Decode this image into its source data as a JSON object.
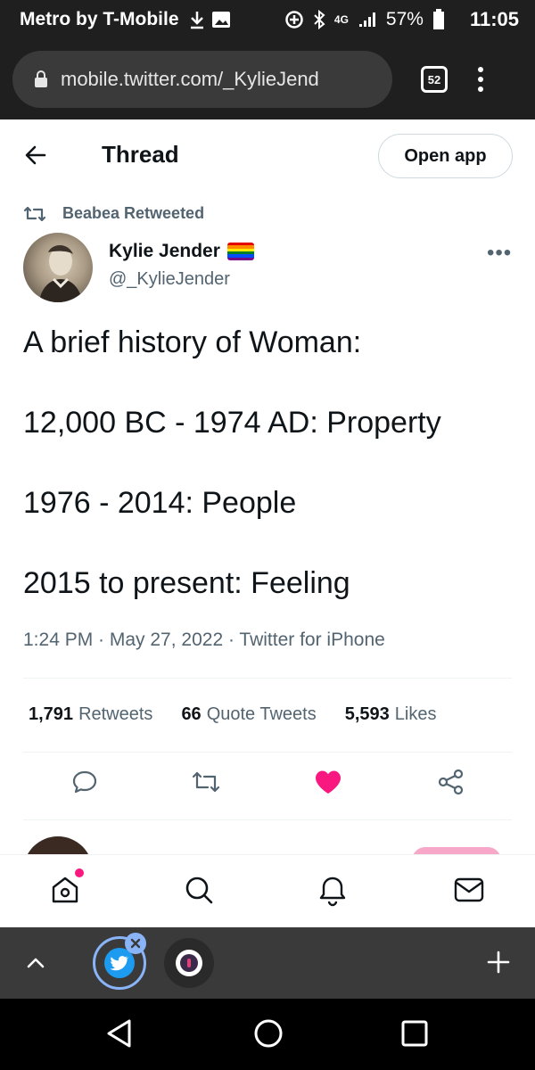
{
  "status_bar": {
    "carrier": "Metro by T-Mobile",
    "network": "4G",
    "battery": "57%",
    "time": "11:05"
  },
  "browser": {
    "url": "mobile.twitter.com/_KylieJend",
    "tab_count": "52"
  },
  "header": {
    "title": "Thread",
    "open_app_label": "Open app"
  },
  "tweet": {
    "retweeted_by": "Beabea Retweeted",
    "author_name": "Kylie Jender",
    "author_handle": "@_KylieJender",
    "lines": [
      "A brief history of Woman:",
      "12,000 BC - 1974 AD: Property",
      "1976 - 2014: People",
      "2015 to present: Feeling"
    ],
    "meta": "1:24 PM · May 27, 2022 · Twitter for iPhone",
    "stats": {
      "retweets_count": "1,791",
      "retweets_label": "Retweets",
      "quotes_count": "66",
      "quotes_label": "Quote Tweets",
      "likes_count": "5,593",
      "likes_label": "Likes"
    }
  },
  "icons": {
    "back": "arrow-left-icon",
    "retweet": "retweet-icon",
    "reply": "reply-icon",
    "like": "heart-icon",
    "share": "share-icon",
    "home": "home-icon",
    "search": "search-icon",
    "notifications": "bell-icon",
    "messages": "mail-icon"
  },
  "colors": {
    "like_active": "#f91880",
    "secondary_text": "#536471",
    "twitter_blue": "#1d9bf0"
  }
}
